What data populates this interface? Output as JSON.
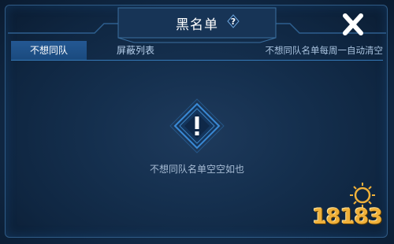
{
  "dialog": {
    "title": "黑名单",
    "help_symbol": "?"
  },
  "tabs": [
    {
      "label": "不想同队",
      "active": true
    },
    {
      "label": "屏蔽列表",
      "active": false
    }
  ],
  "tab_note": "不想同队名单每周一自动清空",
  "empty_state": {
    "icon": "warning-icon",
    "message": "不想同队名单空空如也"
  },
  "watermark": {
    "text": "18183"
  },
  "colors": {
    "accent": "#2e86d8",
    "background": "#15304f",
    "active_tab": "#1f5189",
    "watermark": "#f0b13a"
  }
}
